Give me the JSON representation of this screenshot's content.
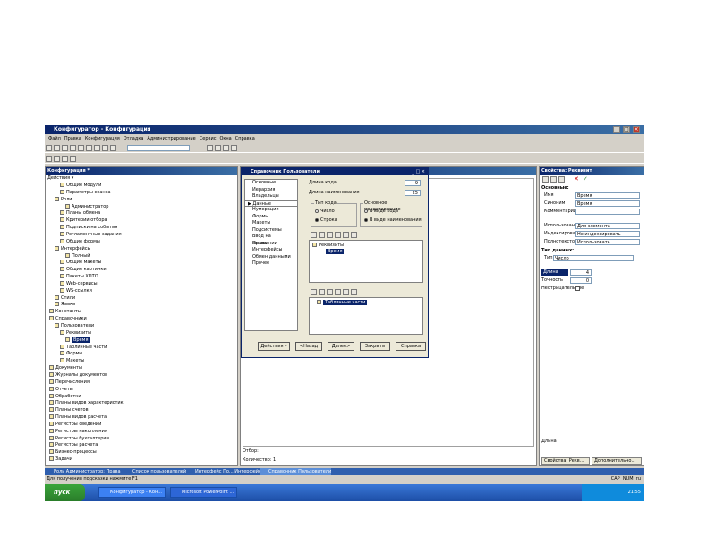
{
  "app": {
    "title": "Конфигуратор - Конфигурация",
    "menu": [
      "Файл",
      "Правка",
      "Конфигурация",
      "Отладка",
      "Администрирование",
      "Сервис",
      "Окна",
      "Справка"
    ]
  },
  "tree_panel": {
    "title": "Конфигурация *",
    "actions_label": "Действия",
    "items": [
      {
        "label": "Общие модули",
        "indent": 2
      },
      {
        "label": "Параметры сеанса",
        "indent": 2
      },
      {
        "label": "Роли",
        "indent": 1
      },
      {
        "label": "Администратор",
        "indent": 3
      },
      {
        "label": "Планы обмена",
        "indent": 2
      },
      {
        "label": "Критерии отбора",
        "indent": 2
      },
      {
        "label": "Подписки на события",
        "indent": 2
      },
      {
        "label": "Регламентные задания",
        "indent": 2
      },
      {
        "label": "Общие формы",
        "indent": 2
      },
      {
        "label": "Интерфейсы",
        "indent": 1
      },
      {
        "label": "Полный",
        "indent": 3
      },
      {
        "label": "Общие макеты",
        "indent": 2
      },
      {
        "label": "Общие картинки",
        "indent": 2
      },
      {
        "label": "Пакеты XDTO",
        "indent": 2
      },
      {
        "label": "Web-сервисы",
        "indent": 2
      },
      {
        "label": "WS-ссылки",
        "indent": 2
      },
      {
        "label": "Стили",
        "indent": 1
      },
      {
        "label": "Языки",
        "indent": 1
      },
      {
        "label": "Константы",
        "indent": 0
      },
      {
        "label": "Справочники",
        "indent": 0
      },
      {
        "label": "Пользователи",
        "indent": 1
      },
      {
        "label": "Реквизиты",
        "indent": 2
      },
      {
        "label": "Время",
        "indent": 3,
        "selected": true
      },
      {
        "label": "Табличные части",
        "indent": 2
      },
      {
        "label": "Формы",
        "indent": 2
      },
      {
        "label": "Макеты",
        "indent": 2
      },
      {
        "label": "Документы",
        "indent": 0
      },
      {
        "label": "Журналы документов",
        "indent": 0
      },
      {
        "label": "Перечисления",
        "indent": 0
      },
      {
        "label": "Отчеты",
        "indent": 0
      },
      {
        "label": "Обработки",
        "indent": 0
      },
      {
        "label": "Планы видов характеристик",
        "indent": 0
      },
      {
        "label": "Планы счетов",
        "indent": 0
      },
      {
        "label": "Планы видов расчета",
        "indent": 0
      },
      {
        "label": "Регистры сведений",
        "indent": 0
      },
      {
        "label": "Регистры накопления",
        "indent": 0
      },
      {
        "label": "Регистры бухгалтерии",
        "indent": 0
      },
      {
        "label": "Регистры расчета",
        "indent": 0
      },
      {
        "label": "Бизнес-процессы",
        "indent": 0
      },
      {
        "label": "Задачи",
        "indent": 0
      }
    ]
  },
  "dialog": {
    "title": "Справочник Пользователи",
    "nav": [
      "Основные",
      "Иерархия",
      "Владельцы",
      "Данные",
      "Нумерация",
      "Формы",
      "Макеты",
      "Подсистемы",
      "Ввод на основании",
      "Права",
      "Интерфейсы",
      "Обмен данными",
      "Прочее"
    ],
    "nav_selected_index": 3,
    "code_length_label": "Длина кода",
    "code_length_value": "9",
    "name_length_label": "Длина наименования",
    "name_length_value": "25",
    "code_type_group": "Тип кода",
    "code_type_options": [
      "Число",
      "Строка"
    ],
    "main_view_group": "Основное представление",
    "main_view_options": [
      "В виде кода",
      "В виде наименования"
    ],
    "attributes_root": "Реквизиты",
    "attributes_child": "Время",
    "tabular_parts": "Табличные части",
    "buttons": {
      "actions": "Действия",
      "back": "<Назад",
      "next": "Далее>",
      "close": "Закрыть",
      "help": "Справка"
    }
  },
  "center_panel": {
    "filter_label": "Отбор:",
    "count_label": "Количество: 1"
  },
  "properties": {
    "title": "Свойства: Реквизит",
    "section_main": "Основные:",
    "name_label": "Имя",
    "name_value": "Время",
    "synonym_label": "Синоним",
    "synonym_value": "Время",
    "comment_label": "Комментарий",
    "usage_label": "Использование",
    "usage_value": "Для элемента",
    "indexing_label": "Индексировать",
    "indexing_value": "Не индексировать",
    "fulltext_label": "Полнотекстовый",
    "fulltext_value": "Использовать",
    "section_type": "Тип данных:",
    "type_label": "Тип",
    "type_value": "Число",
    "length_label": "Длина",
    "length_value": "4",
    "precision_label": "Точность",
    "precision_value": "0",
    "nonnegative_label": "Неотрицательное",
    "footer_label": "Длина",
    "footer_tabs": [
      "Свойства: Рекв...",
      "Дополнительно..."
    ]
  },
  "bottom_tabs": [
    "Роль Администратор: Права",
    "Список пользователей",
    "Интерфейс По... Интерфейс",
    "Справочник Пользователи"
  ],
  "status": {
    "hint": "Для получения подсказки нажмите F1",
    "indicators": [
      "CAP",
      "NUM",
      "ru"
    ]
  },
  "taskbar": {
    "start_label": "пуск",
    "tasks": [
      "Конфигуратор - Кон...",
      "Microsoft PowerPoint ..."
    ],
    "clock": "21:55"
  },
  "colors": {
    "title_blue": "#0a246a",
    "window_gray": "#d4d0c8",
    "taskbar_blue": "#245edb",
    "selection": "#0a246a"
  }
}
